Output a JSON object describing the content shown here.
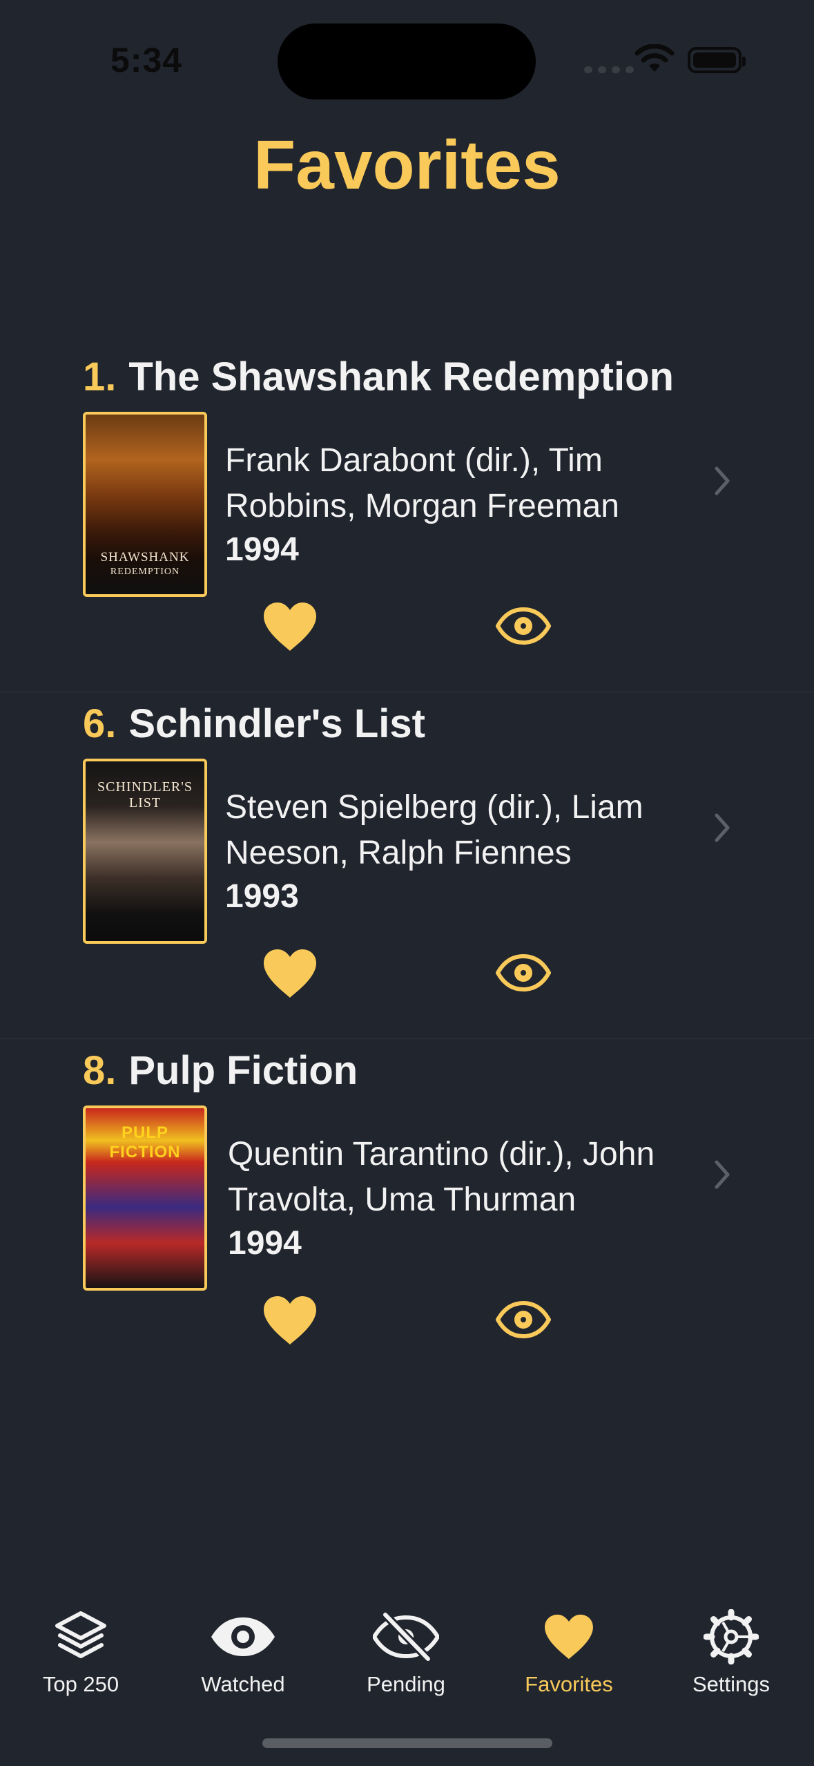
{
  "status_bar": {
    "time": "5:34"
  },
  "page_title": "Favorites",
  "movies": [
    {
      "rank": "1.",
      "title": "The Shawshank Redemption",
      "cast": "Frank Darabont (dir.), Tim Robbins, Morgan Freeman",
      "year": "1994",
      "poster_text": "SHAWSHANK",
      "poster_subtext": "REDEMPTION"
    },
    {
      "rank": "6.",
      "title": "Schindler's List",
      "cast": "Steven Spielberg (dir.), Liam Neeson, Ralph Fiennes",
      "year": "1993",
      "poster_text": "SCHINDLER'S LIST",
      "poster_subtext": ""
    },
    {
      "rank": "8.",
      "title": "Pulp Fiction",
      "cast": "Quentin Tarantino (dir.), John Travolta, Uma Thurman",
      "year": "1994",
      "poster_text": "PULP FICTION",
      "poster_subtext": ""
    }
  ],
  "tab_bar": {
    "tabs": [
      {
        "label": "Top 250",
        "icon": "stack-icon"
      },
      {
        "label": "Watched",
        "icon": "eye-icon"
      },
      {
        "label": "Pending",
        "icon": "eye-slash-icon"
      },
      {
        "label": "Favorites",
        "icon": "heart-icon",
        "active": true
      },
      {
        "label": "Settings",
        "icon": "gear-icon"
      }
    ]
  },
  "colors": {
    "accent": "#f9ca5a",
    "background": "#21252e",
    "text": "#f2f2f2"
  }
}
